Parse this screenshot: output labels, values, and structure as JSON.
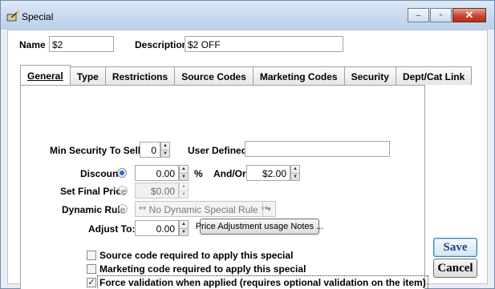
{
  "window": {
    "title": "Special",
    "icon": "wand-icon",
    "controls": {
      "minimize": "–",
      "maximize": "▫",
      "close": "✕"
    }
  },
  "header": {
    "name_label": "Name",
    "name_value": "$2",
    "description_label": "Description",
    "description_value": "$2 OFF"
  },
  "tabs": [
    {
      "label": "General",
      "active": true
    },
    {
      "label": "Type"
    },
    {
      "label": "Restrictions"
    },
    {
      "label": "Source Codes"
    },
    {
      "label": "Marketing Codes"
    },
    {
      "label": "Security"
    },
    {
      "label": "Dept/Cat Link"
    }
  ],
  "general": {
    "min_security_label": "Min Security To Sell:",
    "min_security_value": "0",
    "user_defined_label": "User Defined:",
    "user_defined_value": "",
    "discount_label": "Discount",
    "discount_value": "0.00",
    "percent_symbol": "%",
    "and_or_label": "And/Or:",
    "and_or_value": "$2.00",
    "set_final_price_label": "Set Final Price",
    "set_final_price_value": "$0.00",
    "dynamic_rule_label": "Dynamic Rule",
    "dynamic_rule_value": "** No Dynamic Special Rule **",
    "adjust_to_label": "Adjust To:",
    "adjust_to_value": "0.00",
    "price_notes_button": "Price Adjustment usage Notes ...",
    "selected_pricing_option": "Discount"
  },
  "checkboxes": [
    {
      "label": "Source code required to apply this special",
      "checked": false
    },
    {
      "label": "Marketing code required to apply this special",
      "checked": false
    },
    {
      "label": "Force validation when applied (requires optional validation on the item)",
      "checked": true
    }
  ],
  "buttons": {
    "save": "Save",
    "cancel": "Cancel"
  }
}
